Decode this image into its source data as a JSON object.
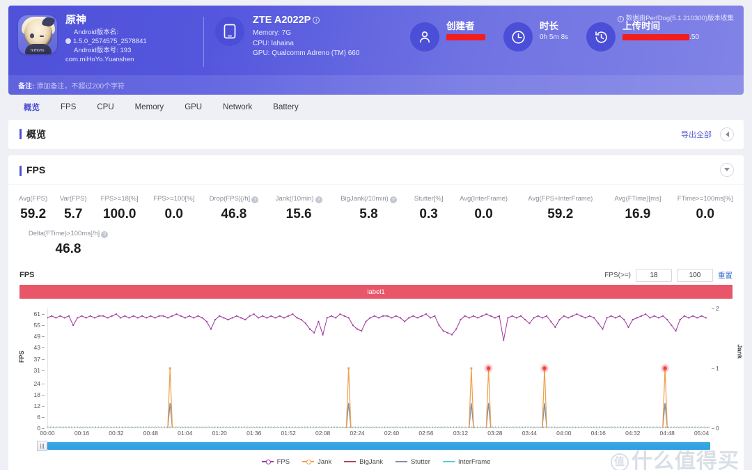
{
  "header": {
    "app": {
      "name": "原神",
      "android_version_name_label": "Android版本名:",
      "android_version_name": "1.5.0_2574575_2578841",
      "android_version_code": "Android版本号: 193",
      "package": "com.miHoYo.Yuanshen",
      "icon": "genshin-app-icon",
      "icon_brand": "miHoYo"
    },
    "device": {
      "name": "ZTE A2022P",
      "info_icon": "info-icon",
      "memory": "Memory: 7G",
      "cpu": "CPU: lahaina",
      "gpu": "GPU: Qualcomm Adreno (TM) 660",
      "icon": "phone-icon"
    },
    "creator": {
      "title": "创建者",
      "value": "",
      "redacted": true,
      "icon": "user-icon"
    },
    "duration": {
      "title": "时长",
      "value": "0h 5m 8s",
      "icon": "clock-icon"
    },
    "upload": {
      "title": "上传时间",
      "value": ".50",
      "redacted": true,
      "icon": "history-icon"
    },
    "perfdog_note": "数据由PerfDog(5.1.210300)版本收集",
    "perfdog_note_icon": "info-circle-icon",
    "note_label": "备注:",
    "note_placeholder": "添加备注，不超过200个字符"
  },
  "tabs": [
    {
      "label": "概览",
      "active": true
    },
    {
      "label": "FPS",
      "active": false
    },
    {
      "label": "CPU",
      "active": false
    },
    {
      "label": "Memory",
      "active": false
    },
    {
      "label": "GPU",
      "active": false
    },
    {
      "label": "Network",
      "active": false
    },
    {
      "label": "Battery",
      "active": false
    }
  ],
  "overview_panel": {
    "title": "概览",
    "export_label": "导出全部",
    "collapse_icon": "triangle-left-icon"
  },
  "fps_panel": {
    "title": "FPS",
    "expand_icon": "triangle-down-icon",
    "metrics": [
      {
        "label": "Avg(FPS)",
        "value": "59.2",
        "help": false
      },
      {
        "label": "Var(FPS)",
        "value": "5.7",
        "help": false
      },
      {
        "label": "FPS>=18[%]",
        "value": "100.0",
        "help": false
      },
      {
        "label": "FPS>=100[%]",
        "value": "0.0",
        "help": false
      },
      {
        "label": "Drop(FPS)[/h]",
        "value": "46.8",
        "help": true
      },
      {
        "label": "Jank(/10min)",
        "value": "15.6",
        "help": true
      },
      {
        "label": "BigJank(/10min)",
        "value": "5.8",
        "help": true
      },
      {
        "label": "Stutter[%]",
        "value": "0.3",
        "help": false
      },
      {
        "label": "Avg(InterFrame)",
        "value": "0.0",
        "help": false
      },
      {
        "label": "Avg(FPS+InterFrame)",
        "value": "59.2",
        "help": false
      },
      {
        "label": "Avg(FTime)[ms]",
        "value": "16.9",
        "help": false
      },
      {
        "label": "FTime>=100ms[%]",
        "value": "0.0",
        "help": false
      }
    ],
    "metrics_row2": [
      {
        "label": "Delta(FTime)>100ms[/h]",
        "value": "46.8",
        "help": true
      }
    ],
    "chart_header": {
      "name": "FPS",
      "threshold_label": "FPS(>=)",
      "threshold_min": "18",
      "threshold_max": "100",
      "reset_label": "重置"
    },
    "label_bar": "label1",
    "scrollbar_handle_icon": "drag-handle-icon",
    "watermark": "什么值得买",
    "watermark_mark": "值"
  },
  "chart_data": {
    "type": "line",
    "title": "FPS",
    "xlabel": "",
    "ylabel": "FPS",
    "y2label": "Jank",
    "grid": false,
    "legend_position": "bottom",
    "xlim": [
      0,
      308
    ],
    "ylim": [
      0,
      64
    ],
    "y2lim": [
      0,
      2
    ],
    "yticks": [
      0,
      6,
      12,
      18,
      24,
      31,
      37,
      43,
      49,
      55,
      61
    ],
    "y2ticks": [
      0,
      1,
      2
    ],
    "xtick_labels": [
      "00:00",
      "00:16",
      "00:32",
      "00:48",
      "01:04",
      "01:20",
      "01:36",
      "01:52",
      "02:08",
      "02:24",
      "02:40",
      "02:56",
      "03:12",
      "03:28",
      "03:44",
      "04:00",
      "04:16",
      "04:32",
      "04:48",
      "05:04"
    ],
    "xtick_seconds": [
      0,
      16,
      32,
      48,
      64,
      80,
      96,
      112,
      128,
      144,
      160,
      176,
      192,
      208,
      224,
      240,
      256,
      272,
      288,
      304
    ],
    "series": [
      {
        "name": "FPS",
        "color": "#a03ca0",
        "axis": "left",
        "x": [
          0,
          2,
          4,
          6,
          8,
          10,
          12,
          14,
          16,
          18,
          20,
          22,
          24,
          26,
          28,
          30,
          32,
          34,
          36,
          38,
          40,
          42,
          44,
          46,
          48,
          50,
          52,
          54,
          56,
          58,
          60,
          62,
          64,
          66,
          68,
          70,
          72,
          74,
          76,
          78,
          80,
          82,
          84,
          86,
          88,
          90,
          92,
          94,
          96,
          98,
          100,
          102,
          104,
          106,
          108,
          110,
          112,
          114,
          116,
          118,
          120,
          122,
          124,
          126,
          128,
          130,
          132,
          134,
          136,
          138,
          140,
          142,
          144,
          146,
          148,
          150,
          152,
          154,
          156,
          158,
          160,
          162,
          164,
          166,
          168,
          170,
          172,
          174,
          176,
          178,
          180,
          182,
          184,
          186,
          188,
          190,
          192,
          194,
          196,
          198,
          200,
          202,
          204,
          206,
          208,
          210,
          212,
          214,
          216,
          218,
          220,
          222,
          224,
          226,
          228,
          230,
          232,
          234,
          236,
          238,
          240,
          242,
          244,
          246,
          248,
          250,
          252,
          254,
          256,
          258,
          260,
          262,
          264,
          266,
          268,
          270,
          272,
          274,
          276,
          278,
          280,
          282,
          284,
          286,
          288,
          290,
          292,
          294,
          296,
          298,
          300,
          302,
          304,
          306
        ],
        "values": [
          59,
          60,
          59,
          60,
          59,
          60,
          55,
          59,
          60,
          59,
          60,
          59,
          60,
          60,
          59,
          60,
          61,
          59,
          60,
          59,
          60,
          59,
          60,
          59,
          60,
          59,
          60,
          60,
          59,
          60,
          61,
          60,
          59,
          60,
          59,
          60,
          59,
          57,
          53,
          58,
          60,
          59,
          58,
          59,
          60,
          59,
          58,
          60,
          61,
          59,
          60,
          59,
          60,
          59,
          60,
          59,
          60,
          61,
          59,
          58,
          56,
          53,
          51,
          57,
          50,
          59,
          60,
          59,
          61,
          60,
          59,
          55,
          53,
          52,
          57,
          59,
          60,
          59,
          60,
          60,
          59,
          60,
          59,
          57,
          59,
          60,
          59,
          60,
          61,
          59,
          60,
          55,
          52,
          51,
          50,
          53,
          58,
          60,
          59,
          60,
          59,
          60,
          61,
          60,
          59,
          60,
          47,
          59,
          60,
          59,
          60,
          58,
          56,
          59,
          60,
          59,
          60,
          57,
          54,
          58,
          60,
          59,
          60,
          61,
          60,
          59,
          60,
          59,
          56,
          53,
          59,
          60,
          59,
          60,
          58,
          54,
          58,
          59,
          60,
          61,
          59,
          60,
          59,
          60,
          58,
          55,
          52,
          58,
          60,
          59,
          60,
          59,
          60,
          59,
          60,
          61,
          60,
          59,
          60,
          59
        ]
      },
      {
        "name": "Jank",
        "color": "#f0a04b",
        "axis": "right",
        "spikes_seconds": [
          57,
          140,
          197,
          205,
          231,
          287
        ],
        "spike_value": 1
      },
      {
        "name": "BigJank",
        "color": "#a84a52",
        "axis": "right",
        "spikes_seconds": [],
        "spike_value": 0
      },
      {
        "name": "Stutter",
        "color": "#7b8fa8",
        "axis": "right",
        "spikes_seconds": [
          57,
          140,
          197,
          205,
          231,
          287
        ],
        "spike_value": 0.42
      },
      {
        "name": "InterFrame",
        "color": "#4fd0d8",
        "axis": "right",
        "spikes_seconds": [],
        "spike_value": 0
      }
    ],
    "highlighted_points_seconds": [
      205,
      231,
      287
    ],
    "highlight_color": "#ef4444",
    "legend": [
      {
        "name": "FPS",
        "color": "#a03ca0",
        "marker": "dot"
      },
      {
        "name": "Jank",
        "color": "#f0a04b",
        "marker": "dot"
      },
      {
        "name": "BigJank",
        "color": "#a84a52",
        "marker": "line"
      },
      {
        "name": "Stutter",
        "color": "#7b8fa8",
        "marker": "line"
      },
      {
        "name": "InterFrame",
        "color": "#4fd0d8",
        "marker": "line"
      }
    ]
  }
}
